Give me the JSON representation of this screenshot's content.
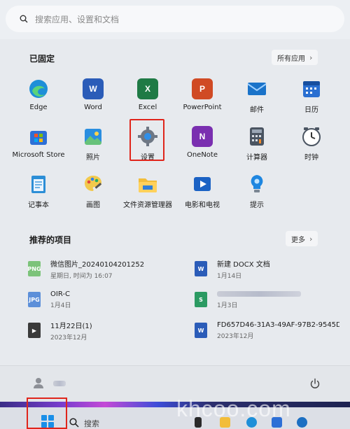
{
  "search": {
    "placeholder": "搜索应用、设置和文档"
  },
  "pinned": {
    "title": "已固定",
    "all_apps": "所有应用",
    "apps": [
      {
        "label": "Edge",
        "icon": "edge-icon",
        "color": "#1e8fd8"
      },
      {
        "label": "Word",
        "icon": "word-icon",
        "color": "#2b5cb8",
        "glyph": "W"
      },
      {
        "label": "Excel",
        "icon": "excel-icon",
        "color": "#1f7a45",
        "glyph": "X"
      },
      {
        "label": "PowerPoint",
        "icon": "powerpoint-icon",
        "color": "#d04a24",
        "glyph": "P"
      },
      {
        "label": "邮件",
        "icon": "mail-icon",
        "color": "#1a73c9"
      },
      {
        "label": "日历",
        "icon": "calendar-icon",
        "color": "#2a6fd1"
      },
      {
        "label": "Microsoft Store",
        "icon": "store-icon",
        "color": "#2d6fd6"
      },
      {
        "label": "照片",
        "icon": "photos-icon",
        "color": "#2a8ee0"
      },
      {
        "label": "设置",
        "icon": "settings-gear-icon",
        "color": "#6e7784"
      },
      {
        "label": "OneNote",
        "icon": "onenote-icon",
        "color": "#7a2fb0",
        "glyph": "N"
      },
      {
        "label": "计算器",
        "icon": "calculator-icon",
        "color": "#4a5461"
      },
      {
        "label": "时钟",
        "icon": "clock-icon",
        "color": "#5a6470"
      },
      {
        "label": "记事本",
        "icon": "notepad-icon",
        "color": "#2c8ed6"
      },
      {
        "label": "画图",
        "icon": "paint-icon",
        "color": "#1f7fd0"
      },
      {
        "label": "文件资源管理器",
        "icon": "folder-icon",
        "color": "#f2bd3a"
      },
      {
        "label": "电影和电视",
        "icon": "movies-tv-icon",
        "color": "#1b62c4"
      },
      {
        "label": "提示",
        "icon": "tips-icon",
        "color": "#1e86e0"
      }
    ]
  },
  "recommended": {
    "title": "推荐的项目",
    "more": "更多",
    "items": [
      {
        "name": "微信图片_20240104201252",
        "sub": "星期日, 时间为 16:07",
        "icon": "image-file-icon",
        "color": "#7cc37a",
        "tag": "PNG"
      },
      {
        "name": "新建 DOCX 文档",
        "sub": "1月14日",
        "icon": "word-file-icon",
        "color": "#2b5cb8",
        "tag": "W"
      },
      {
        "name": "OIR-C",
        "sub": "1月4日",
        "icon": "jpg-file-icon",
        "color": "#5c8fd9",
        "tag": "JPG"
      },
      {
        "name": "",
        "sub": "1月3日",
        "icon": "sheet-file-icon",
        "color": "#2b9a62",
        "tag": "S"
      },
      {
        "name": "11月22日(1)",
        "sub": "2023年12月",
        "icon": "video-file-icon",
        "color": "#3a3a3a",
        "tag": "▶"
      },
      {
        "name": "FD657D46-31A3-49AF-97B2-9545D...",
        "sub": "2023年12月",
        "icon": "word-file-icon",
        "color": "#2b5cb8",
        "tag": "W"
      }
    ]
  },
  "taskbar": {
    "search_label": "搜索",
    "watermark": "khcoo.com"
  },
  "colors": {
    "highlight": "#e0251b",
    "accent": "#1a8fe8"
  }
}
